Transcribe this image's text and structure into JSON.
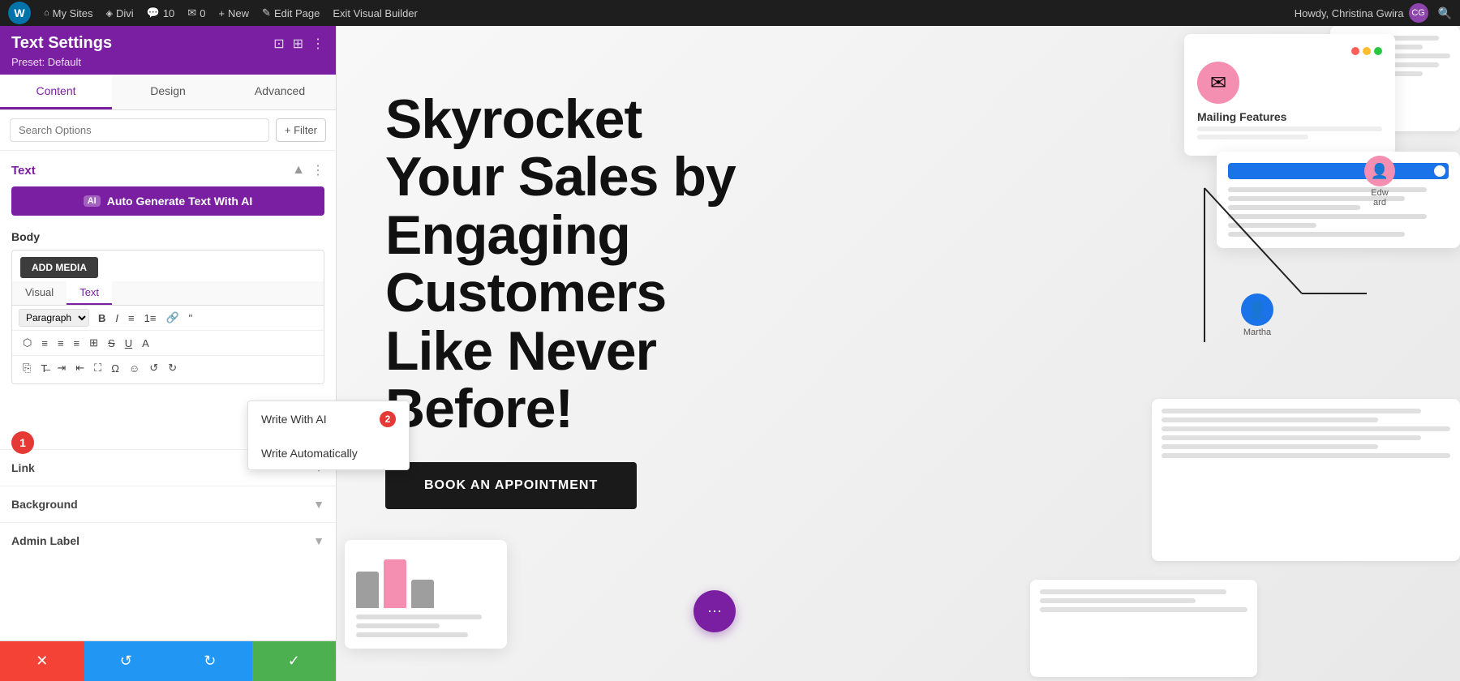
{
  "adminBar": {
    "logo": "W",
    "items": [
      {
        "icon": "⚑",
        "label": "My Sites"
      },
      {
        "icon": "◈",
        "label": "Divi"
      },
      {
        "icon": "○",
        "label": "10"
      },
      {
        "icon": "✉",
        "label": "0"
      },
      {
        "icon": "+",
        "label": "New"
      }
    ],
    "editPage": "Edit Page",
    "exitBuilder": "Exit Visual Builder",
    "userName": "Howdy, Christina Gwira",
    "searchIcon": "🔍"
  },
  "panel": {
    "title": "Text Settings",
    "preset": "Preset: Default",
    "tabs": [
      "Content",
      "Design",
      "Advanced"
    ],
    "activeTab": "Content",
    "searchPlaceholder": "Search Options",
    "filterLabel": "+ Filter",
    "sections": {
      "text": {
        "label": "Text",
        "aiBtn": "Auto Generate Text With AI",
        "aiBadge": "AI",
        "bodyLabel": "Body",
        "addMedia": "ADD MEDIA",
        "editorTabs": [
          "Visual",
          "Text"
        ],
        "activeEditorTab": "Text",
        "formatOptions": [
          "Paragraph"
        ],
        "linkLabel": "Link",
        "backgroundLabel": "Background",
        "adminLabel": "Admin Label"
      }
    },
    "aiPopup": {
      "items": [
        {
          "label": "Write With AI",
          "badge": "2"
        },
        {
          "label": "Write Automatically"
        }
      ]
    },
    "footer": {
      "cancelIcon": "✕",
      "resetIcon": "↺",
      "redoIcon": "↻",
      "saveIcon": "✓"
    }
  },
  "canvas": {
    "heroHeading": "Skyrocket\nYour Sales by\nEngaging\nCustomers\nLike Never\nBefore!",
    "ctaButton": "Book An Appointment",
    "mailingCard": {
      "title": "Mailing Features"
    },
    "profileEdward": "Edward",
    "profileMartha": "Martha",
    "purpleDotIcon": "⋯"
  }
}
